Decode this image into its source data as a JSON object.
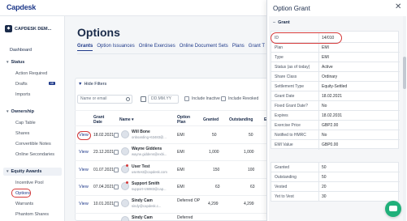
{
  "app": {
    "logo": "Capdesk"
  },
  "sidebar": {
    "company": "CAPDESK DEM...",
    "items": {
      "dashboard": "Dashboard",
      "status_head": "Status",
      "action_required": "Action Required",
      "drafts": "Drafts",
      "drafts_badge": "48",
      "imports": "Imports",
      "ownership_head": "Ownership",
      "cap_table": "Cap Table",
      "shares": "Shares",
      "convertible_notes": "Convertible Notes",
      "online_secondaries": "Online Secondaries",
      "equity_awards_head": "Equity Awards",
      "incentive_pool": "Incentive Pool",
      "options": "Options",
      "warrants": "Warrants",
      "phantom_shares": "Phantom Shares"
    }
  },
  "main": {
    "title": "Options",
    "tabs": [
      "Grants",
      "Option Issuances",
      "Online Exercises",
      "Online Document Sets",
      "Plans",
      "Grant T"
    ],
    "hide_filters": "Hide Filters",
    "filters": {
      "name_placeholder": "Name or email",
      "date_placeholder": "DD.MM.YY",
      "include_inactive": "Include Inactive",
      "include_revoked": "Include Revoked"
    },
    "table": {
      "headers": {
        "grant_date": "Grant Date",
        "name": "Name",
        "option_plan": "Option Plan",
        "granted": "Granted",
        "outstanding": "Outstanding",
        "exercised": "E"
      },
      "view_label": "View",
      "rows": [
        {
          "date": "18.02.2021",
          "name": "Will Bone",
          "email": "onboarding+63483@...",
          "plan": "EMI",
          "granted": "50",
          "outstanding": "50",
          "exercised": ""
        },
        {
          "date": "23.12.2021",
          "name": "Wayne Giddens",
          "email": "wayne.giddens@exbi...",
          "plan": "EMI",
          "granted": "1,000",
          "outstanding": "1,000",
          "exercised": ""
        },
        {
          "date": "01.07.2021",
          "name": "User Test",
          "email": "usertest@capdesk.com",
          "plan": "EMI",
          "granted": "150",
          "outstanding": "100",
          "exercised": ""
        },
        {
          "date": "07.04.2021",
          "name": "Support Smith",
          "email": "support+26983@cap...",
          "plan": "EMI",
          "granted": "63",
          "outstanding": "63",
          "exercised": ""
        },
        {
          "date": "10.01.2021",
          "name": "Sindy Cam",
          "email": "sindy@capdesk.c...",
          "plan": "Deferred OP",
          "granted": "4,299",
          "outstanding": "4,299",
          "exercised": ""
        },
        {
          "date": "",
          "name": "Sindy Cam",
          "email": "",
          "plan": "Deferred",
          "granted": "",
          "outstanding": "",
          "exercised": ""
        }
      ]
    }
  },
  "panel": {
    "title": "Option Grant",
    "section": "Grant",
    "details": [
      {
        "key": "ID",
        "value": "14/010"
      },
      {
        "key": "Plan",
        "value": "EMI"
      },
      {
        "key": "Type",
        "value": "EMI"
      },
      {
        "key": "Status (as of today)",
        "value": "Active"
      },
      {
        "key": "Share Class",
        "value": "Ordinary"
      },
      {
        "key": "Settlement Type",
        "value": "Equity-Settled"
      },
      {
        "key": "Grant Date",
        "value": "18.02.2021"
      },
      {
        "key": "Fixed Grant Date?",
        "value": "No"
      },
      {
        "key": "Expires",
        "value": "18.02.2031"
      },
      {
        "key": "Exercise Price",
        "value": "GBP2.00"
      },
      {
        "key": "Notified to HMRC",
        "value": "No"
      },
      {
        "key": "EMI Value",
        "value": "GBP0.00"
      }
    ],
    "amounts": [
      {
        "key": "Granted",
        "value": "50"
      },
      {
        "key": "Outstanding",
        "value": "50"
      },
      {
        "key": "Vested",
        "value": "20"
      },
      {
        "key": "Yet to Vest",
        "value": "30"
      }
    ]
  },
  "colors": {
    "brand": "#1f3a8a",
    "highlight": "#d63a3a",
    "chat": "#20b07a"
  }
}
